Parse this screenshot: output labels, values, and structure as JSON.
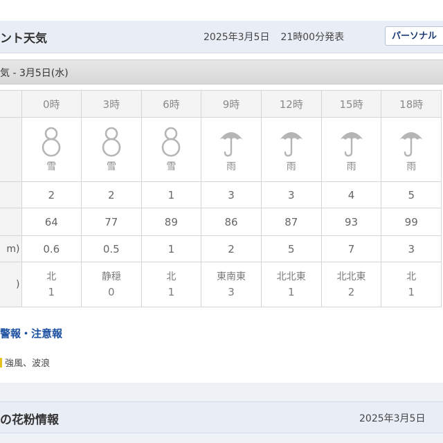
{
  "header": {
    "title": "ント天気",
    "issued_date": "2025年3月5日",
    "issued_time": "21時00分発表",
    "personal_button": "パーソナル"
  },
  "date_bar": {
    "label": "気 - 3月5日(水)"
  },
  "forecast": {
    "row_labels": {
      "rain": "m)",
      "wind": ")"
    },
    "hours": [
      "0時",
      "3時",
      "6時",
      "9時",
      "12時",
      "15時",
      "18時"
    ],
    "weather": [
      {
        "icon": "snowman-icon",
        "label": "雪"
      },
      {
        "icon": "snowman-icon",
        "label": "雪"
      },
      {
        "icon": "snowman-icon",
        "label": "雪"
      },
      {
        "icon": "umbrella-icon",
        "label": "雨"
      },
      {
        "icon": "umbrella-icon",
        "label": "雨"
      },
      {
        "icon": "umbrella-icon",
        "label": "雨"
      },
      {
        "icon": "umbrella-icon",
        "label": "雨"
      }
    ],
    "temperature": [
      "2",
      "2",
      "1",
      "3",
      "3",
      "4",
      "5"
    ],
    "humidity": [
      "64",
      "77",
      "89",
      "86",
      "87",
      "93",
      "99"
    ],
    "precipitation": [
      "0.6",
      "0.5",
      "1",
      "2",
      "5",
      "7",
      "3"
    ],
    "wind_direction": [
      "北",
      "静穏",
      "北",
      "東南東",
      "北北東",
      "北北東",
      "北"
    ],
    "wind_speed": [
      "1",
      "0",
      "1",
      "3",
      "1",
      "2",
      "1"
    ]
  },
  "warnings": {
    "title": "警報・注意報",
    "items": "強風、波浪"
  },
  "pollen": {
    "title": "の花粉情報",
    "date": "2025年3月5日"
  },
  "colors": {
    "header_bg": "#e9eef6",
    "warning_title": "#1a4fa0",
    "warning_marker": "#e8c11a",
    "icon_gray": "#b5b5b5"
  }
}
